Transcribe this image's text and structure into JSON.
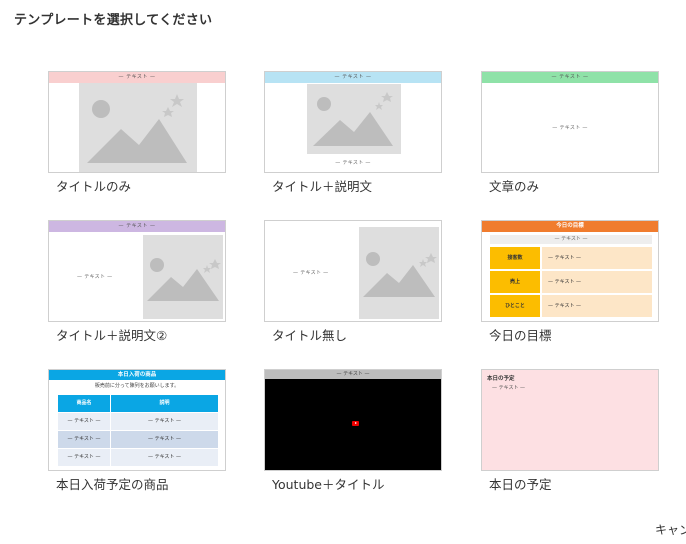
{
  "dialog": {
    "title": "テンプレートを選択してください",
    "cancel_label": "キャン"
  },
  "placeholder_text": "— テキスト —",
  "colors": {
    "title_only_bar": "#f9cfcf",
    "title_desc_bar": "#b7e3f4",
    "text_only_bar": "#8fe2a8",
    "title_desc2_bar": "#cdb7e2",
    "goal_header": "#f07c2e",
    "arrival_header": "#0aa6e4",
    "plan_bg": "#fde0e3"
  },
  "templates": [
    {
      "label": "タイトルのみ",
      "bar": "— テキスト —"
    },
    {
      "label": "タイトル＋説明文",
      "bar": "— テキスト —",
      "caption": "— テキスト —"
    },
    {
      "label": "文章のみ",
      "bar": "— テキスト —",
      "body": "— テキスト —"
    },
    {
      "label": "タイトル＋説明文②",
      "bar": "— テキスト —",
      "body": "— テキスト —"
    },
    {
      "label": "タイトル無し",
      "body": "— テキスト —"
    },
    {
      "label": "今日の目標",
      "header": "今日の目標",
      "sub": "— テキスト —",
      "rows": [
        {
          "key": "接客数",
          "value": "— テキスト —"
        },
        {
          "key": "売上",
          "value": "— テキスト —"
        },
        {
          "key": "ひとこと",
          "value": "— テキスト —"
        }
      ]
    },
    {
      "label": "本日入荷予定の商品",
      "header": "本日入荷の商品",
      "note": "販売前に分って陳列をお願いします。",
      "columns": [
        "商品名",
        "説明"
      ],
      "rows": [
        [
          "— テキスト —",
          "— テキスト —"
        ],
        [
          "— テキスト —",
          "— テキスト —"
        ],
        [
          "— テキスト —",
          "— テキスト —"
        ]
      ]
    },
    {
      "label": "Youtube＋タイトル",
      "bar": "— テキスト —"
    },
    {
      "label": "本日の予定",
      "title": "本日の予定",
      "body": "— テキスト —"
    }
  ]
}
